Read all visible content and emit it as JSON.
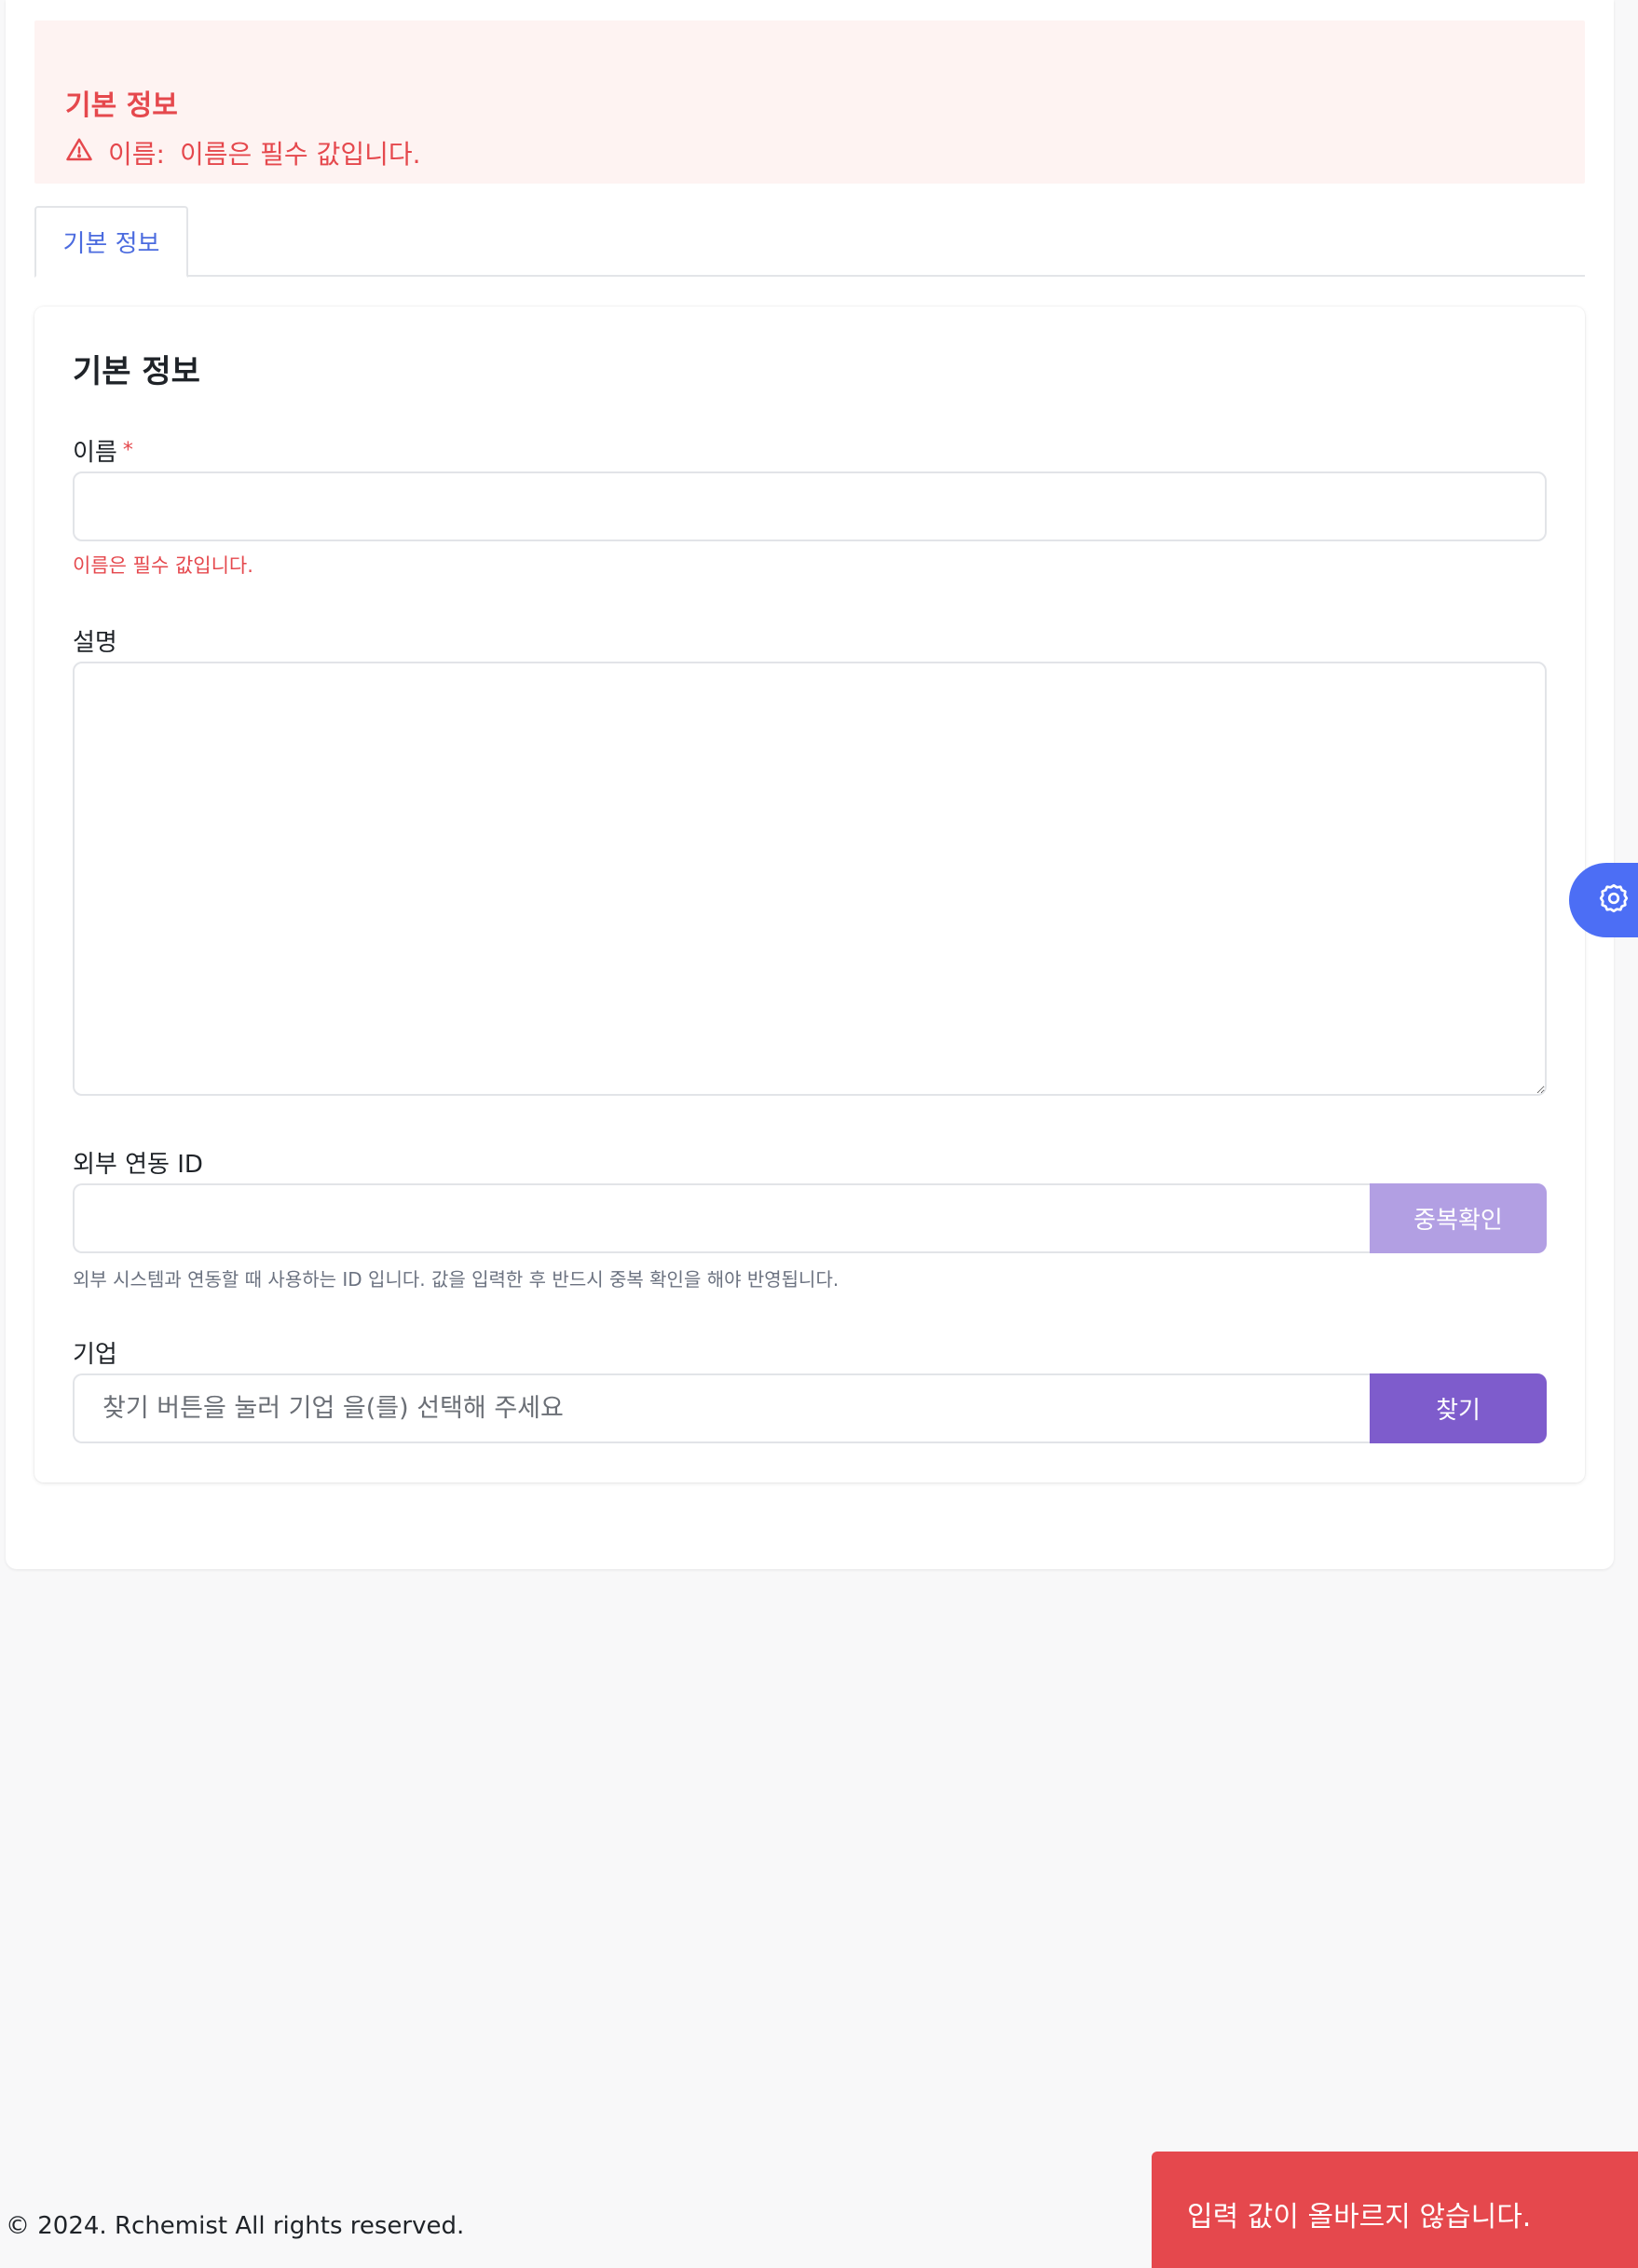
{
  "error_summary": {
    "title": "기본 정보",
    "field": "이름:",
    "message": "이름은 필수 값입니다."
  },
  "tabs": [
    {
      "label": "기본 정보",
      "active": true
    }
  ],
  "form": {
    "title": "기본 정보",
    "name": {
      "label": "이름",
      "required_mark": "*",
      "value": "",
      "error": "이름은 필수 값입니다."
    },
    "description": {
      "label": "설명",
      "value": ""
    },
    "external_id": {
      "label": "외부 연동 ID",
      "value": "",
      "button": "중복확인",
      "help": "외부 시스템과 연동할 때 사용하는 ID 입니다. 값을 입력한 후 반드시 중복 확인을 해야 반영됩니다."
    },
    "company": {
      "label": "기업",
      "placeholder": "찾기 버튼을 눌러 기업 을(를) 선택해 주세요",
      "button": "찾기"
    }
  },
  "footer": {
    "text": "© 2024. Rchemist All rights reserved."
  },
  "toast": {
    "message": "입력 값이 올바르지 않습니다."
  },
  "colors": {
    "error": "#e5484d",
    "primary": "#4c6ef5",
    "purple": "#7e5ccc",
    "purple_light": "#b29fe3"
  }
}
